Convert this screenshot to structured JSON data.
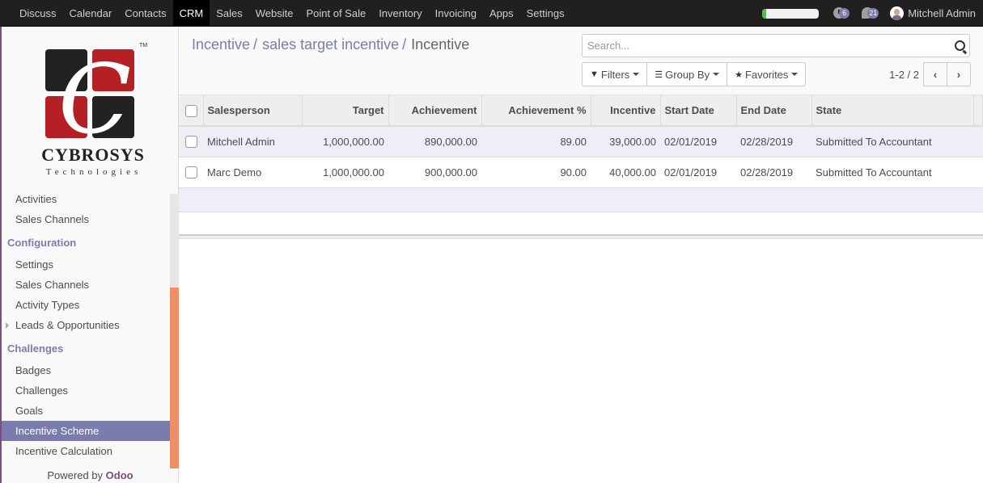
{
  "topbar": {
    "menu": [
      "Discuss",
      "Calendar",
      "Contacts",
      "CRM",
      "Sales",
      "Website",
      "Point of Sale",
      "Inventory",
      "Invoicing",
      "Apps",
      "Settings"
    ],
    "active_index": 3,
    "progress_fraction": 0.07,
    "activity_count": "6",
    "message_count": "21",
    "user_name": "Mitchell Admin"
  },
  "sidebar": {
    "logo": {
      "name": "CYBROSYS",
      "sub": "Technologies",
      "tm": "TM"
    },
    "items": [
      {
        "type": "item",
        "label": "Activities"
      },
      {
        "type": "item",
        "label": "Sales Channels"
      },
      {
        "type": "section",
        "label": "Configuration"
      },
      {
        "type": "item",
        "label": "Settings"
      },
      {
        "type": "item",
        "label": "Sales Channels"
      },
      {
        "type": "item",
        "label": "Activity Types"
      },
      {
        "type": "item",
        "label": "Leads & Opportunities",
        "caret": true
      },
      {
        "type": "section",
        "label": "Challenges"
      },
      {
        "type": "item",
        "label": "Badges"
      },
      {
        "type": "item",
        "label": "Challenges"
      },
      {
        "type": "item",
        "label": "Goals"
      },
      {
        "type": "item",
        "label": "Incentive Scheme",
        "active": true
      },
      {
        "type": "item",
        "label": "Incentive Calculation"
      }
    ],
    "powered_prefix": "Powered by",
    "powered_brand": "Odoo"
  },
  "breadcrumb": {
    "items": [
      "Incentive",
      "sales target incentive"
    ],
    "separator": "/",
    "current": "Incentive"
  },
  "search": {
    "placeholder": "Search...",
    "value": ""
  },
  "buttons": {
    "filters": "Filters",
    "group_by": "Group By",
    "favorites": "Favorites"
  },
  "pager": {
    "value": "1-2 / 2",
    "prev": "‹",
    "next": "›"
  },
  "table": {
    "columns": [
      {
        "label": "Salesperson",
        "align": "left"
      },
      {
        "label": "Target",
        "align": "right"
      },
      {
        "label": "Achievement",
        "align": "right"
      },
      {
        "label": "Achievement %",
        "align": "right"
      },
      {
        "label": "Incentive",
        "align": "right"
      },
      {
        "label": "Start Date",
        "align": "left"
      },
      {
        "label": "End Date",
        "align": "left"
      },
      {
        "label": "State",
        "align": "left"
      }
    ],
    "rows": [
      [
        "Mitchell Admin",
        "1,000,000.00",
        "890,000.00",
        "89.00",
        "39,000.00",
        "02/01/2019",
        "02/28/2019",
        "Submitted To Accountant"
      ],
      [
        "Marc Demo",
        "1,000,000.00",
        "900,000.00",
        "90.00",
        "40,000.00",
        "02/01/2019",
        "02/28/2019",
        "Submitted To Accountant"
      ]
    ]
  },
  "colors": {
    "accent": "#7c7bad",
    "brand": "#7c4d7e",
    "navbar": "#221f20",
    "scroll_thumb": "#ee8f66",
    "logo_red": "#b52025",
    "logo_dark": "#222222"
  }
}
